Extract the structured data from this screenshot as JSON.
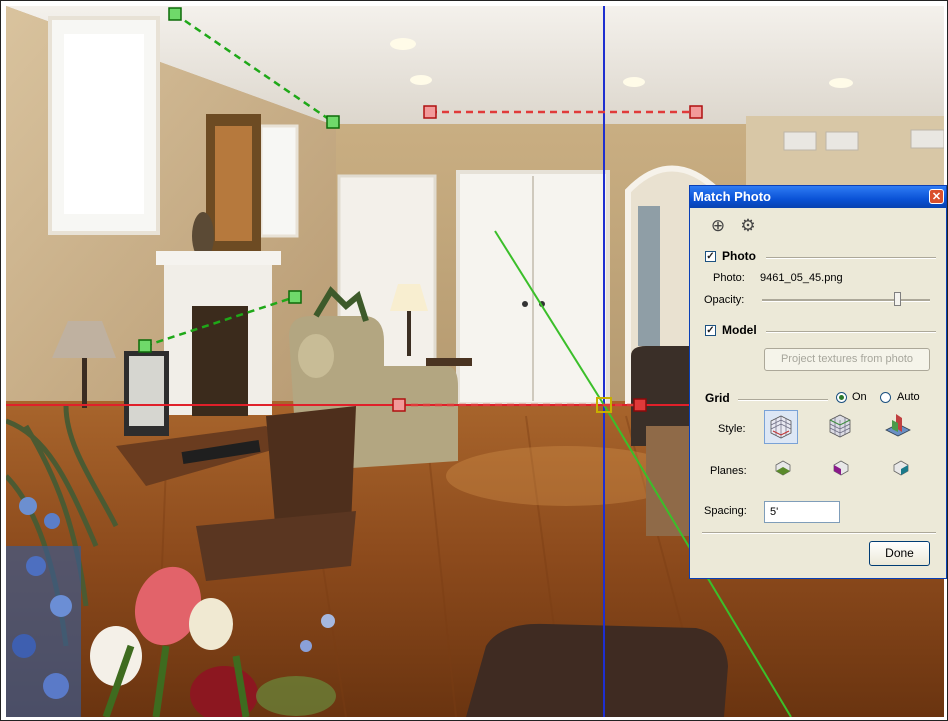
{
  "dialog": {
    "title": "Match Photo",
    "close_glyph": "✕",
    "toolbar_icons": [
      "add-photo-icon",
      "gears-icon"
    ],
    "photo_section": {
      "label": "Photo",
      "checked": true,
      "photo_label": "Photo:",
      "photo_name": "9461_05_45.png",
      "opacity_label": "Opacity:",
      "opacity_value": 0.82
    },
    "model_section": {
      "label": "Model",
      "checked": true,
      "project_button": "Project textures from photo"
    },
    "grid_section": {
      "label": "Grid",
      "radio_on": "On",
      "radio_auto": "Auto",
      "selected": "On",
      "style_label": "Style:",
      "style_icons": [
        "grid-style-inside-icon",
        "grid-style-above-icon",
        "grid-style-below-icon"
      ],
      "planes_label": "Planes:",
      "plane_icons": [
        "plane-red-green-icon",
        "plane-red-blue-icon",
        "plane-green-blue-icon"
      ],
      "spacing_label": "Spacing:",
      "spacing_value": "5'"
    },
    "done_button": "Done"
  },
  "colors": {
    "red_axis": "#e0202a",
    "green_axis": "#3bbf2a",
    "blue_axis": "#1e2fd0",
    "vp_green": "#1fa818",
    "vp_red": "#e03a3a"
  }
}
